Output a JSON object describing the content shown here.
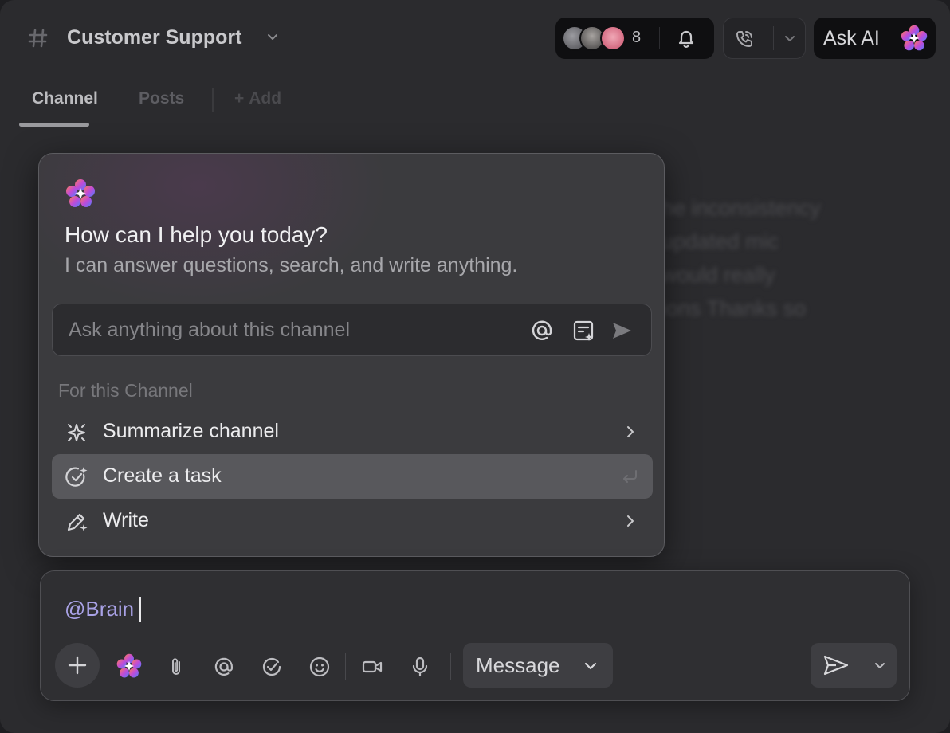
{
  "header": {
    "title": "Customer Support",
    "member_count": "8",
    "ask_ai_label": "Ask AI"
  },
  "tabs": [
    {
      "label": "Channel",
      "active": true
    },
    {
      "label": "Posts",
      "active": false
    }
  ],
  "add_tab_label": "Add",
  "background_text": {
    "lines": [
      "he inconsistency",
      "updated mic",
      "would really",
      "ions Thanks so"
    ]
  },
  "ai_popup": {
    "heading": "How can I help you today?",
    "subheading": "I can answer questions, search, and write anything.",
    "input_placeholder": "Ask anything about this channel",
    "section_label": "For this Channel",
    "items": [
      {
        "label": "Summarize channel",
        "icon": "sparkle-icon",
        "trailing": "chevron-right-icon"
      },
      {
        "label": "Create a task",
        "icon": "task-check-icon",
        "trailing": "enter-key-icon",
        "active": true
      },
      {
        "label": "Write",
        "icon": "pen-sparkle-icon",
        "trailing": "chevron-right-icon"
      }
    ]
  },
  "composer": {
    "text": "@Brain",
    "message_type": "Message"
  },
  "colors": {
    "background": "#2b2b2e",
    "popup": "#3b3b3e",
    "mention": "#a9a2e6",
    "active_item": "#58585c"
  }
}
